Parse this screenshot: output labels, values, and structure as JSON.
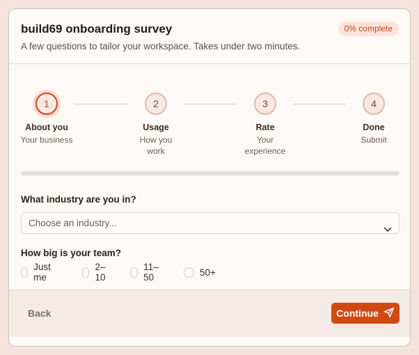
{
  "header": {
    "title": "build69 onboarding survey",
    "subtitle": "A few questions to tailor your workspace. Takes under two minutes.",
    "progress_badge": "0% complete"
  },
  "steps": [
    {
      "number": "1",
      "label": "About you",
      "desc": "Your business",
      "state": "active"
    },
    {
      "number": "2",
      "label": "Usage",
      "desc": "How you work",
      "state": "upcoming"
    },
    {
      "number": "3",
      "label": "Rate",
      "desc": "Your experience",
      "state": "upcoming"
    },
    {
      "number": "4",
      "label": "Done",
      "desc": "Submit",
      "state": "upcoming"
    }
  ],
  "progress": {
    "percent": 0
  },
  "industry": {
    "question": "What industry are you in?",
    "selected": "Choose an industry..."
  },
  "team": {
    "question": "How big is your team?",
    "options": [
      "Just me",
      "2–10",
      "11–50",
      "50+"
    ]
  },
  "footer": {
    "back_label": "Back",
    "continue_label": "Continue"
  },
  "colors": {
    "accent": "#cf4a12",
    "background": "#f4e3dc",
    "card": "#fdf9f6"
  },
  "icons": {
    "select": "chevron-down-icon",
    "continue": "send-icon"
  }
}
